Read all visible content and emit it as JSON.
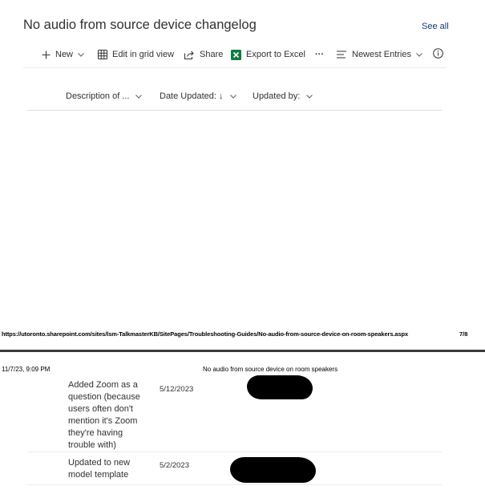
{
  "list": {
    "title": "No audio from source device changelog",
    "see_all": "See all"
  },
  "toolbar": {
    "new_label": "New",
    "edit_grid_label": "Edit in grid view",
    "share_label": "Share",
    "export_label": "Export to Excel",
    "more_label": "···",
    "view_label": "Newest Entries"
  },
  "columns": {
    "description": "Description of ...",
    "date_updated": "Date Updated: ↓",
    "updated_by": "Updated by:"
  },
  "print": {
    "url": "https://utoronto.sharepoint.com/sites/lsm-TalkmasterKB/SitePages/Troubleshooting-Guides/No-audio-from-source-device-on-room-speakers.aspx",
    "page_number": "7/8",
    "header_datetime": "11/7/23, 9:09 PM",
    "header_title": "No audio from source device on room speakers"
  },
  "rows": [
    {
      "description": "Added Zoom as a question (because users often don't mention it's Zoom they're having trouble with)",
      "date": "5/12/2023"
    },
    {
      "description": "Updated to new model template",
      "date": "5/2/2023"
    }
  ],
  "colors": {
    "link": "#0f3a7a",
    "excel_green": "#107c41",
    "text": "#323130"
  }
}
